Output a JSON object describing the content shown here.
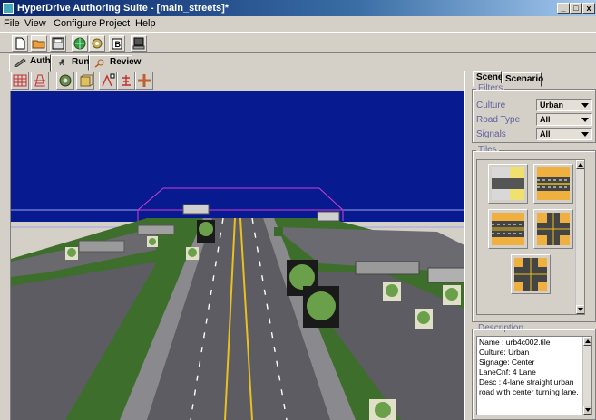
{
  "window": {
    "title": "HyperDrive Authoring Suite - [main_streets]*",
    "minimize": "_",
    "maximize": "□",
    "close": "x"
  },
  "menu": [
    "File",
    "View",
    "Configure",
    "Project",
    "Help"
  ],
  "toolbar": {
    "buttons": [
      "new-file",
      "open-folder",
      "save",
      "globe-arrow",
      "settings-gear",
      "b-document",
      "computer"
    ]
  },
  "modes": {
    "tabs": [
      {
        "label": "Author",
        "icon": "pencil-icon",
        "active": true
      },
      {
        "label": "Run",
        "icon": "runner-icon",
        "active": false
      },
      {
        "label": "Review",
        "icon": "magnifier-icon",
        "active": false
      }
    ]
  },
  "tools": {
    "buttons": [
      "grid-icon",
      "road-grid-icon",
      "camera-icon",
      "layer-icon",
      "node-tool-icon",
      "signal-icon",
      "intersection-icon"
    ]
  },
  "panel": {
    "tabs": [
      "Scene",
      "Scenario"
    ],
    "filters": {
      "title": "Filters",
      "rows": [
        {
          "label": "Culture",
          "value": "Urban"
        },
        {
          "label": "Road Type",
          "value": "All"
        },
        {
          "label": "Signals",
          "value": "All"
        }
      ]
    },
    "tiles": {
      "title": "Tiles",
      "items": [
        "straight-road-tile",
        "four-lane-straight-tile",
        "four-lane-center-turn-tile",
        "crosswalk-intersection-tile",
        "four-way-intersection-tile"
      ]
    },
    "description": {
      "title": "Description",
      "lines": [
        "Name   : urb4c002.tile",
        "Culture: Urban",
        "Signage: Center",
        "LaneCnf: 4 Lane",
        "Desc    : 4-lane straight urban",
        "road with center turning lane."
      ]
    }
  },
  "colors": {
    "sky": "#071a8f",
    "grass": "#3e7a28",
    "asphalt": "#5c5c62",
    "lane_yellow": "#e8c020",
    "selection": "#d040d0",
    "window_bg": "#d4d0c8"
  }
}
